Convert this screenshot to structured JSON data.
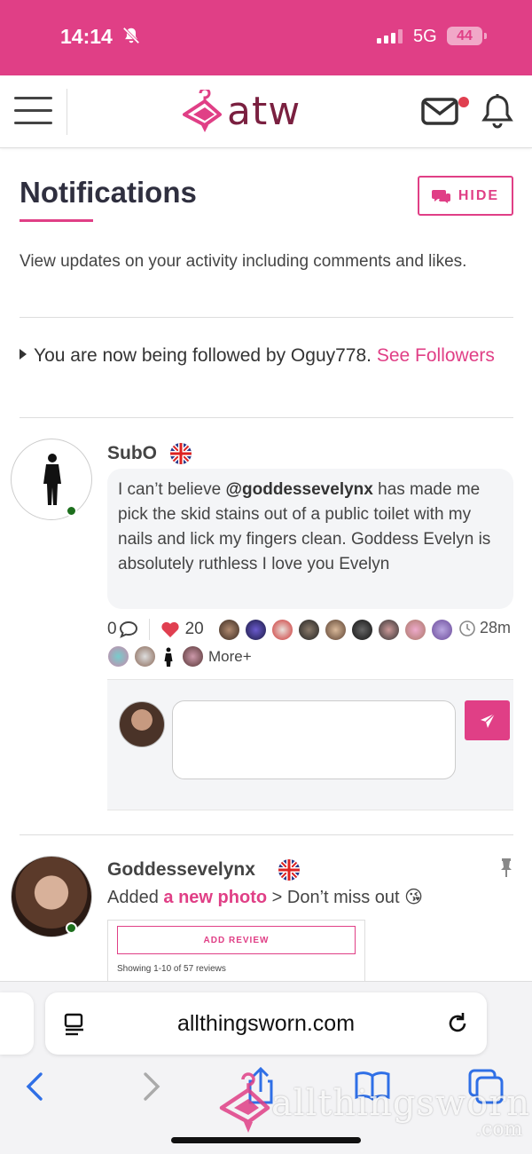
{
  "status": {
    "time": "14:14",
    "network": "5G",
    "battery": "44"
  },
  "logo": {
    "text": "atw"
  },
  "page": {
    "title": "Notifications",
    "hide_label": "HIDE",
    "intro": "View updates on your activity including comments and likes."
  },
  "follow": {
    "text": "You are now being followed by Oguy778.",
    "link": "See Followers"
  },
  "post1": {
    "user": "SubO",
    "mention": "@goddessevelynx",
    "text_before": "I can’t believe ",
    "text_after": " has made me pick the skid stains out of a public toilet with my nails and lick my fingers clean. Goddess Evelyn is absolutely ruthless I love you Evelyn",
    "comments": "0",
    "likes": "20",
    "time": "28m",
    "more": "More+"
  },
  "post2": {
    "user": "Goddessevelynx",
    "added": "Added",
    "link": "a new photo",
    "suffix": "> Don’t miss out 😘",
    "add_review": "ADD REVIEW",
    "showing": "Showing 1-10 of 57 reviews"
  },
  "browser": {
    "url": "allthingsworn.com"
  },
  "watermark": {
    "text": "allthingsworn",
    "suffix": ".com"
  },
  "colors": {
    "brand": "#e03f86",
    "online": "#1d6f1d",
    "logo_text": "#7a2040"
  }
}
